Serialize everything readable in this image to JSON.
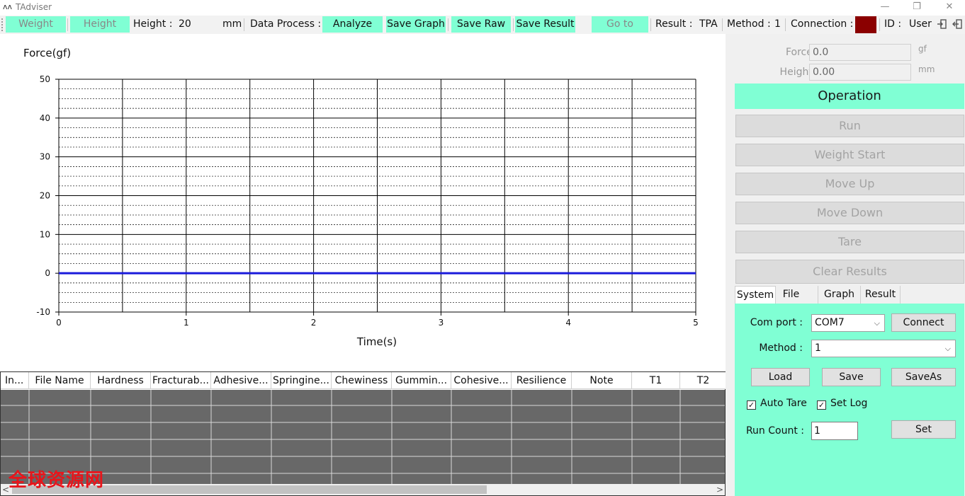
{
  "window": {
    "title": "TAdviser",
    "logo": "ʌʌ",
    "minimize": "—",
    "restore": "❐",
    "close": "✕"
  },
  "toolbar": {
    "weight_label": "Weight",
    "height_btn_label": "Height",
    "height_label": "Height :",
    "height_value": "20",
    "height_unit": "mm",
    "data_process_label": "Data Process :",
    "analyze_label": "Analyze",
    "save_graph_label": "Save Graph",
    "save_raw_label": "Save Raw",
    "save_result_label": "Save Result",
    "goto_label": "Go to",
    "result_label": "Result :",
    "result_value": "TPA",
    "method_label": "Method :",
    "method_value": "1",
    "connection_label": "Connection :",
    "connection_color": "#8b0000",
    "id_label": "ID :",
    "id_value": "User",
    "login_icon": "login-icon",
    "logout_icon": "logout-icon"
  },
  "chart_data": {
    "type": "line",
    "ylabel": "Force(gf)",
    "xlabel": "Time(s)",
    "xlim": [
      0,
      5
    ],
    "ylim": [
      -10,
      50
    ],
    "xticks": [
      0,
      1,
      2,
      3,
      4,
      5
    ],
    "yticks": [
      -10,
      0,
      10,
      20,
      30,
      40,
      50
    ],
    "grid": true,
    "series": [
      {
        "color": "#1a1adb",
        "x": [
          0,
          5
        ],
        "y": [
          0,
          0
        ]
      }
    ]
  },
  "table": {
    "columns": [
      "In...",
      "File Name",
      "Hardness",
      "Fracturab...",
      "Adhesive...",
      "Springine...",
      "Chewiness",
      "Gummin...",
      "Cohesive...",
      "Resilience",
      "Note",
      "T1",
      "T2"
    ]
  },
  "watermark": "全球资源网",
  "readouts": {
    "force_label": "Force :",
    "force_value": "0.0",
    "force_unit": "gf",
    "height_label": "Height :",
    "height_value": "0.00",
    "height_unit": "mm"
  },
  "operation": {
    "header": "Operation",
    "buttons": [
      "Run",
      "Weight Start",
      "Move Up",
      "Move Down",
      "Tare",
      "Clear Results"
    ]
  },
  "tabs": [
    "System",
    "File",
    "Graph",
    "Result"
  ],
  "system": {
    "com_port_label": "Com port :",
    "com_port_value": "COM7",
    "connect_label": "Connect",
    "method_label": "Method :",
    "method_value": "1",
    "load_label": "Load",
    "save_label": "Save",
    "saveas_label": "SaveAs",
    "auto_tare_label": "Auto Tare",
    "set_log_label": "Set Log",
    "check_mark": "✓",
    "run_count_label": "Run Count :",
    "run_count_value": "1",
    "set_label": "Set"
  }
}
